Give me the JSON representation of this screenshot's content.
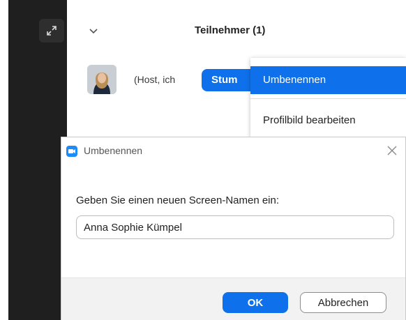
{
  "participants_panel": {
    "title": "Teilnehmer (1)",
    "participant_name": "(Host, ich",
    "mute_button": "Stum"
  },
  "context_menu": {
    "items": [
      {
        "label": "Umbenennen",
        "selected": true
      },
      {
        "label": "Profilbild bearbeiten",
        "selected": false
      }
    ]
  },
  "rename_dialog": {
    "title": "Umbenennen",
    "prompt": "Geben Sie einen neuen Screen-Namen ein:",
    "input_value": "Anna Sophie Kümpel",
    "ok_label": "OK",
    "cancel_label": "Abbrechen"
  },
  "colors": {
    "accent": "#0e71eb",
    "dark_sidebar": "#1f1f1f"
  },
  "icons": {
    "expand": "expand-arrows-icon",
    "collapse": "chevron-down-icon",
    "close": "close-icon",
    "app": "zoom-app-icon"
  }
}
